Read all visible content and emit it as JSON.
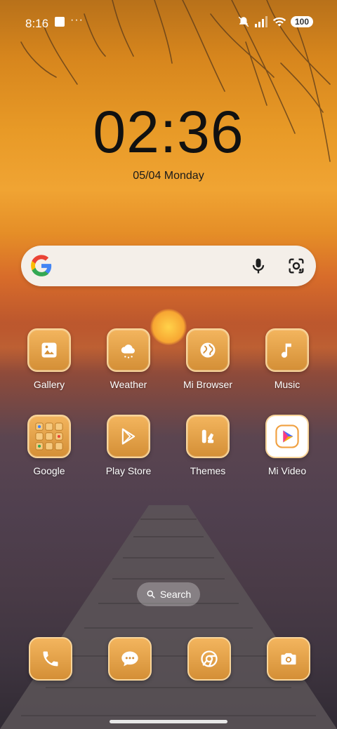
{
  "status": {
    "time": "8:16",
    "dots": "···",
    "battery": "100"
  },
  "clock": {
    "time": "02:36",
    "date": "05/04 Monday"
  },
  "search": {
    "label": "Search"
  },
  "apps_row1": [
    {
      "label": "Gallery",
      "icon": "gallery-icon"
    },
    {
      "label": "Weather",
      "icon": "weather-icon"
    },
    {
      "label": "Mi Browser",
      "icon": "globe-icon"
    },
    {
      "label": "Music",
      "icon": "music-note-icon"
    }
  ],
  "apps_row2": [
    {
      "label": "Google",
      "icon": "folder-icon"
    },
    {
      "label": "Play Store",
      "icon": "play-store-icon"
    },
    {
      "label": "Themes",
      "icon": "themes-icon"
    },
    {
      "label": "Mi Video",
      "icon": "mi-video-icon"
    }
  ],
  "dock": [
    {
      "icon": "phone-icon"
    },
    {
      "icon": "messages-icon"
    },
    {
      "icon": "chrome-icon"
    },
    {
      "icon": "camera-icon"
    }
  ]
}
